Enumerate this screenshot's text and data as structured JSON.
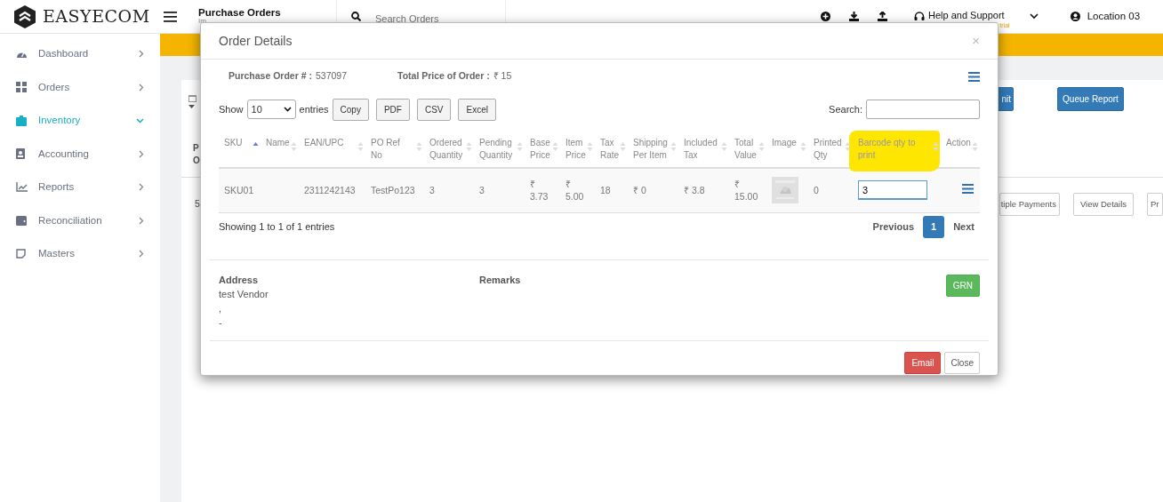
{
  "header": {
    "logo": "EASYECOM",
    "title": "Purchase Orders",
    "subtitle": "Im",
    "search": {
      "placeholder": "Search Orders"
    },
    "help": "Help and Support",
    "help_badge": "trial",
    "location": "Location 03"
  },
  "sidebar": {
    "items": [
      {
        "label": "Dashboard",
        "selected": false,
        "expanded": false
      },
      {
        "label": "Orders",
        "selected": false,
        "expanded": false
      },
      {
        "label": "Inventory",
        "selected": true,
        "expanded": true
      },
      {
        "label": "Accounting",
        "selected": false,
        "expanded": false
      },
      {
        "label": "Reports",
        "selected": false,
        "expanded": false
      },
      {
        "label": "Reconciliation",
        "selected": false,
        "expanded": false
      },
      {
        "label": "Masters",
        "selected": false,
        "expanded": false
      }
    ]
  },
  "page": {
    "top_buttons": [
      "nit",
      "Queue Report"
    ],
    "column_1": [
      "P",
      "O"
    ],
    "cell": "5",
    "row_buttons": [
      "tiple Payments",
      "View Details",
      "Pr"
    ]
  },
  "modal": {
    "title": "Order Details",
    "close": "×",
    "po_label": "Purchase Order # :",
    "po_value": "537097",
    "total_label": "Total Price of Order :",
    "total_value": "₹ 15",
    "show_label": "Show",
    "page_size": "10",
    "entries_label": "entries",
    "export_buttons": [
      "Copy",
      "PDF",
      "CSV",
      "Excel"
    ],
    "search_label": "Search:",
    "table": {
      "columns": [
        {
          "label": "SKU",
          "sorted": true,
          "highlighted": false
        },
        {
          "label": "Name",
          "sorted": false,
          "highlighted": false
        },
        {
          "label": "EAN/UPC",
          "sorted": false,
          "highlighted": false
        },
        {
          "label": "PO Ref No",
          "sorted": false,
          "highlighted": false
        },
        {
          "label": "Ordered Quantity",
          "sorted": false,
          "highlighted": false
        },
        {
          "label": "Pending Quantity",
          "sorted": false,
          "highlighted": false
        },
        {
          "label": "Base Price",
          "sorted": false,
          "highlighted": false
        },
        {
          "label": "Item Price",
          "sorted": false,
          "highlighted": false
        },
        {
          "label": "Tax Rate",
          "sorted": false,
          "highlighted": false
        },
        {
          "label": "Shipping Per Item",
          "sorted": false,
          "highlighted": false
        },
        {
          "label": "Included Tax",
          "sorted": false,
          "highlighted": false
        },
        {
          "label": "Total Value",
          "sorted": false,
          "highlighted": false
        },
        {
          "label": "Image",
          "sorted": false,
          "highlighted": false
        },
        {
          "label": "Printed Qty",
          "sorted": false,
          "highlighted": false
        },
        {
          "label": "Barcode qty to print",
          "sorted": false,
          "highlighted": true
        },
        {
          "label": "Action",
          "sorted": false,
          "highlighted": false
        }
      ],
      "rows": [
        [
          {
            "kind": "text",
            "text": "SKU01"
          },
          {
            "kind": "empty"
          },
          {
            "kind": "text",
            "text": "2311242143"
          },
          {
            "kind": "text",
            "text": "TestPo123"
          },
          {
            "kind": "text",
            "text": "3"
          },
          {
            "kind": "text",
            "text": "3"
          },
          {
            "kind": "text",
            "text": "₹ 3.73"
          },
          {
            "kind": "text",
            "text": "₹ 5.00"
          },
          {
            "kind": "text",
            "text": "18"
          },
          {
            "kind": "text",
            "text": "₹ 0"
          },
          {
            "kind": "text",
            "text": "₹ 3.8"
          },
          {
            "kind": "text",
            "text": "₹ 15.00"
          },
          {
            "kind": "picture"
          },
          {
            "kind": "text",
            "text": "0"
          },
          {
            "kind": "input",
            "value": "3"
          },
          {
            "kind": "menu"
          }
        ]
      ]
    },
    "info": "Showing 1 to 1 of 1 entries",
    "pagination": [
      {
        "label": "Previous",
        "selected": false
      },
      {
        "label": "1",
        "selected": true
      },
      {
        "label": "Next",
        "selected": false
      }
    ],
    "address_label": "Address",
    "address_lines": [
      "test Vendor",
      ",",
      "-"
    ],
    "remarks_label": "Remarks",
    "grn": "GRN",
    "email": "Email",
    "close_button": "Close"
  }
}
